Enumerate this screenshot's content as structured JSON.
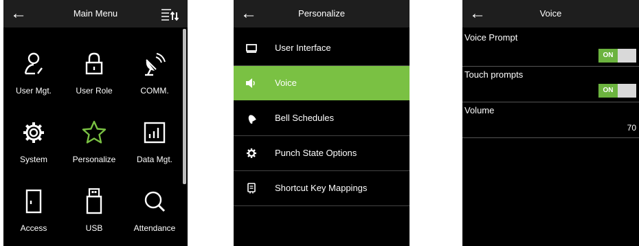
{
  "main_menu": {
    "title": "Main Menu",
    "items": [
      {
        "label": "User Mgt.",
        "icon": "user-icon"
      },
      {
        "label": "User Role",
        "icon": "lock-icon"
      },
      {
        "label": "COMM.",
        "icon": "satellite-dish-icon"
      },
      {
        "label": "System",
        "icon": "gear-icon"
      },
      {
        "label": "Personalize",
        "icon": "star-icon"
      },
      {
        "label": "Data Mgt.",
        "icon": "chart-icon"
      },
      {
        "label": "Access",
        "icon": "door-icon"
      },
      {
        "label": "USB",
        "icon": "usb-drive-icon"
      },
      {
        "label": "Attendance",
        "icon": "search-icon"
      }
    ],
    "highlight_color": "#7ac143"
  },
  "personalize": {
    "title": "Personalize",
    "items": [
      {
        "label": "User Interface",
        "icon": "monitor-icon",
        "selected": false
      },
      {
        "label": "Voice",
        "icon": "speaker-icon",
        "selected": true
      },
      {
        "label": "Bell Schedules",
        "icon": "bell-icon",
        "selected": false
      },
      {
        "label": "Punch State Options",
        "icon": "gear-icon",
        "selected": false
      },
      {
        "label": "Shortcut Key Mappings",
        "icon": "keypad-icon",
        "selected": false
      }
    ],
    "selected_color": "#7ac143"
  },
  "voice": {
    "title": "Voice",
    "voice_prompt": {
      "label": "Voice Prompt",
      "state": "ON"
    },
    "touch_prompts": {
      "label": "Touch prompts",
      "state": "ON"
    },
    "volume": {
      "label": "Volume",
      "value": "70"
    },
    "toggle_on_color": "#6cb33f"
  }
}
